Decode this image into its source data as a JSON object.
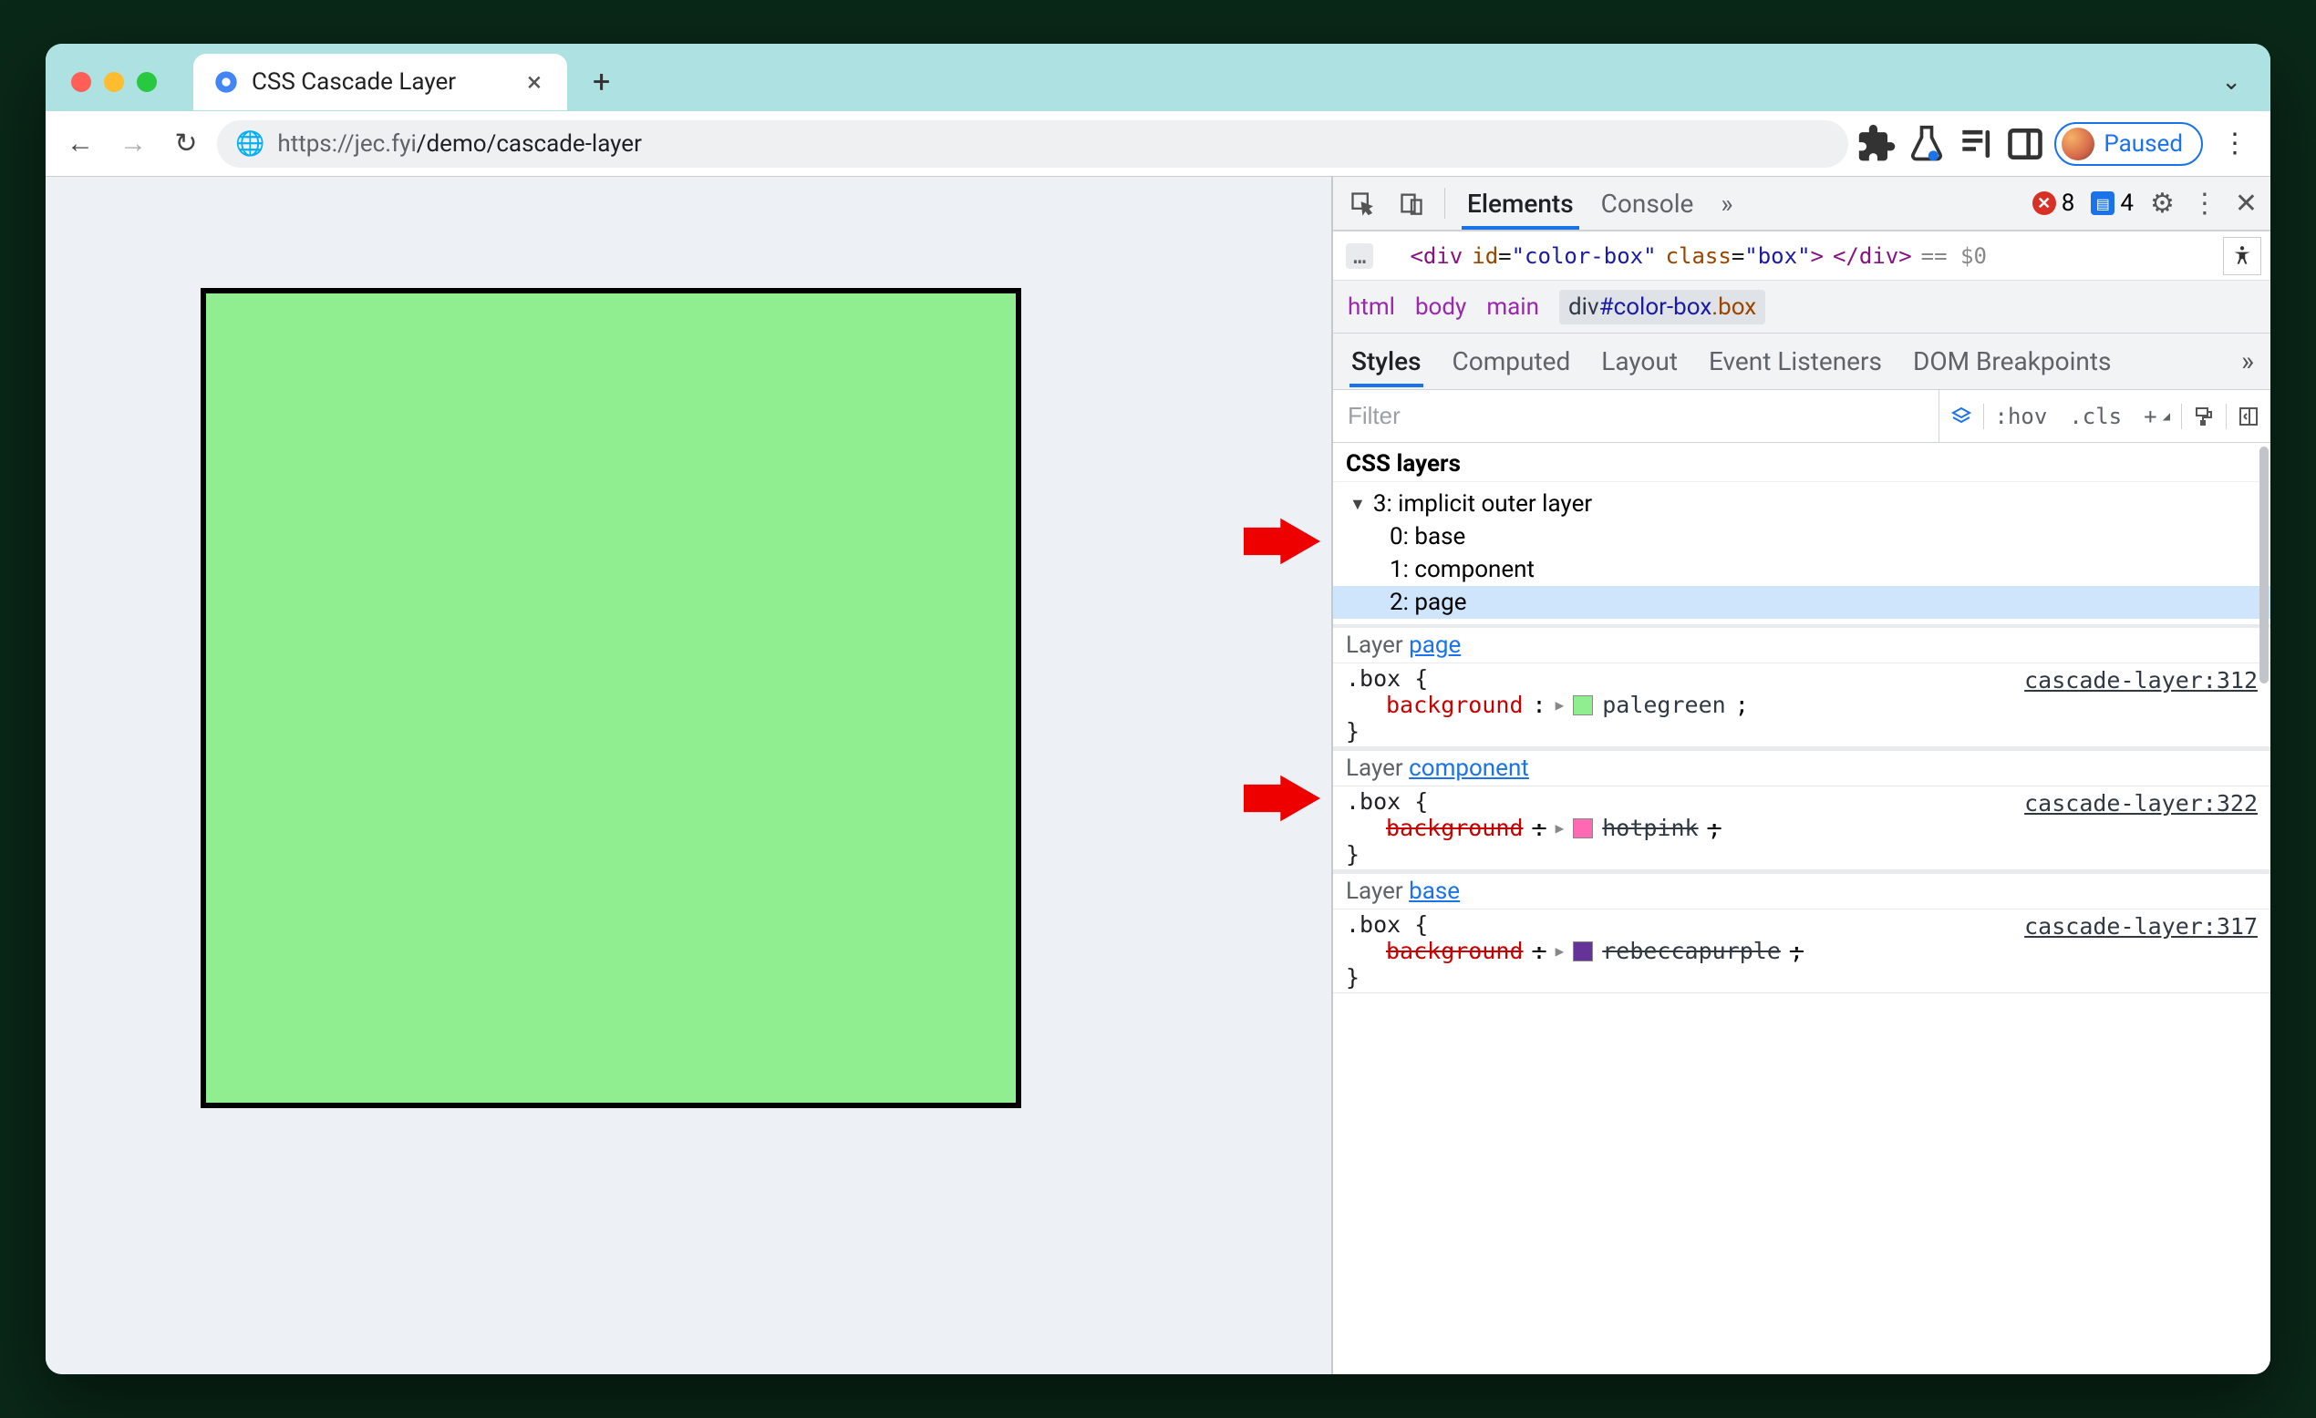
{
  "tab": {
    "title": "CSS Cascade Layer",
    "close": "×",
    "newTab": "+",
    "chevron": "⌄"
  },
  "toolbar": {
    "back": "←",
    "forward": "→",
    "reload": "↻",
    "url_host": "https://jec.fyi",
    "url_path": "/demo/cascade-layer",
    "paused": "Paused",
    "menu": "⋮"
  },
  "devtools": {
    "tabs": {
      "elements": "Elements",
      "console": "Console",
      "more": "»"
    },
    "counts": {
      "errors": "8",
      "messages": "4"
    },
    "source_line": {
      "tag_open": "<div",
      "id_attr": "id",
      "id_val": "\"color-box\"",
      "class_attr": "class",
      "class_val": "\"box\"",
      "tag_suffix": ">",
      "tag_close": "</div>",
      "var": " == $0"
    },
    "breadcrumb": {
      "html": "html",
      "body": "body",
      "main": "main",
      "sel_el": "div",
      "sel_id": "#color-box",
      "sel_class": ".box"
    },
    "stylesTabs": {
      "styles": "Styles",
      "computed": "Computed",
      "layout": "Layout",
      "listeners": "Event Listeners",
      "dom": "DOM Breakpoints",
      "more": "»"
    },
    "filter": {
      "placeholder": "Filter",
      "hov": ":hov",
      "cls": ".cls",
      "plus": "+"
    },
    "layers": {
      "header": "CSS layers",
      "outer": "3: implicit outer layer",
      "i0": "0: base",
      "i1": "1: component",
      "i2": "2: page"
    },
    "rules": [
      {
        "layerLabel": "Layer ",
        "layerName": "page",
        "selector": ".box {",
        "close": "}",
        "prop": "background",
        "colon": ":",
        "val": "palegreen",
        "semicolon": ";",
        "swatch": "#90ee90",
        "source": "cascade-layer:312",
        "struck": false
      },
      {
        "layerLabel": "Layer ",
        "layerName": "component",
        "selector": ".box {",
        "close": "}",
        "prop": "background",
        "colon": ":",
        "val": "hotpink",
        "semicolon": ";",
        "swatch": "#ff69b4",
        "source": "cascade-layer:322",
        "struck": true
      },
      {
        "layerLabel": "Layer ",
        "layerName": "base",
        "selector": ".box {",
        "close": "}",
        "prop": "background",
        "colon": ":",
        "val": "rebeccapurple",
        "semicolon": ";",
        "swatch": "#663399",
        "source": "cascade-layer:317",
        "struck": true
      }
    ]
  }
}
